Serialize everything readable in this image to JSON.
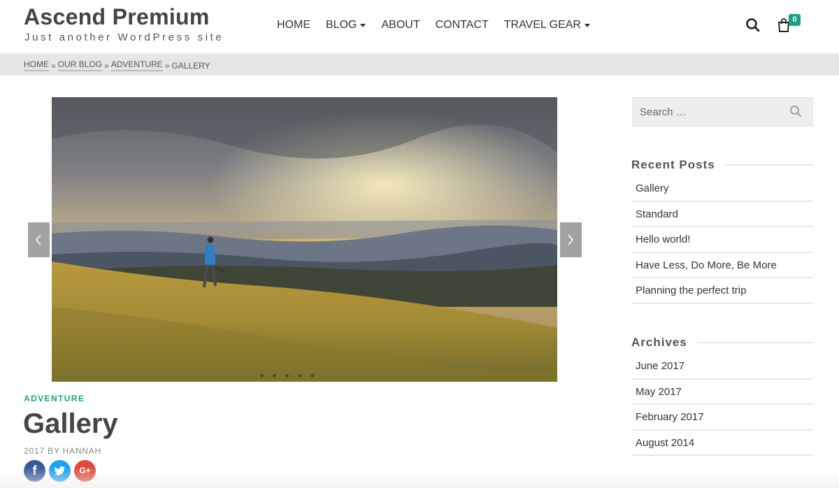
{
  "site": {
    "title": "Ascend Premium",
    "tagline": "Just another WordPress site"
  },
  "nav": {
    "items": [
      {
        "label": "HOME",
        "dropdown": false
      },
      {
        "label": "BLOG",
        "dropdown": true
      },
      {
        "label": "ABOUT",
        "dropdown": false
      },
      {
        "label": "CONTACT",
        "dropdown": false
      },
      {
        "label": "TRAVEL GEAR",
        "dropdown": true
      }
    ]
  },
  "header": {
    "search_icon": "search-icon",
    "cart_icon": "shopping-bag-icon",
    "cart_count": "0"
  },
  "breadcrumb": {
    "links": [
      "HOME",
      "OUR BLOG",
      "ADVENTURE"
    ],
    "separator": "»",
    "current": "GALLERY"
  },
  "slider": {
    "image": "hiker on grassy hillside at sunset",
    "slide_count": 5,
    "prev_icon": "chevron-left-icon",
    "next_icon": "chevron-right-icon"
  },
  "post": {
    "category": "ADVENTURE",
    "title": "Gallery",
    "byline": "2017 BY HANNAH",
    "share": {
      "facebook": "f",
      "twitter": "t",
      "googleplus": "G+"
    }
  },
  "sidebar": {
    "search": {
      "placeholder": "Search …"
    },
    "recent_posts": {
      "title": "Recent Posts",
      "items": [
        "Gallery",
        "Standard",
        "Hello world!",
        "Have Less, Do More, Be More",
        "Planning the perfect trip"
      ]
    },
    "archives": {
      "title": "Archives",
      "items": [
        "June 2017",
        "May 2017",
        "February 2017",
        "August 2014"
      ]
    }
  },
  "colors": {
    "accent": "#1f9e85",
    "facebook": "#3b5998",
    "twitter": "#1da1f2",
    "googleplus": "#dd4b39"
  }
}
